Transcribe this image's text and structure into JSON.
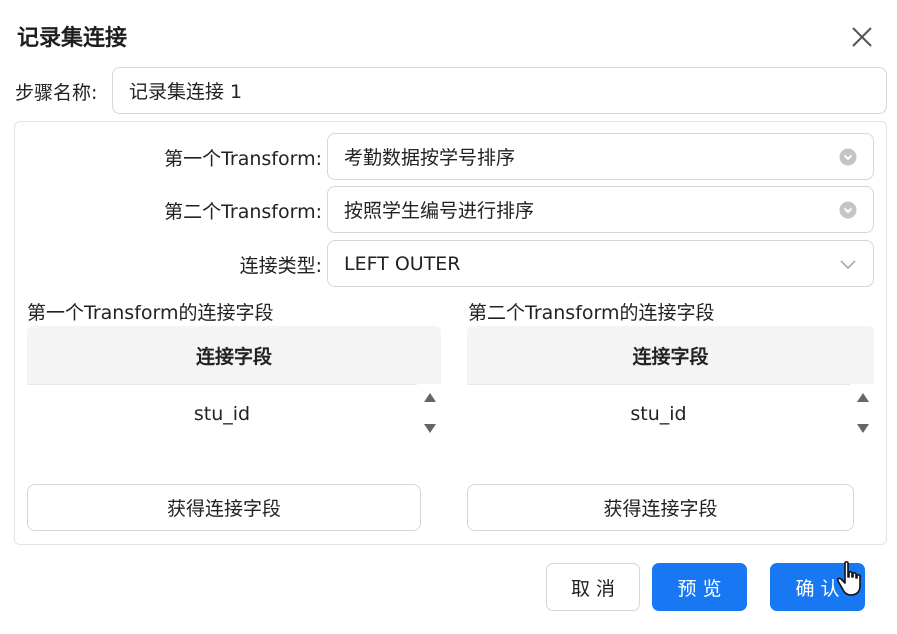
{
  "dialog": {
    "title": "记录集连接",
    "close_icon": "close-icon"
  },
  "step": {
    "label": "步骤名称:",
    "value": "记录集连接 1"
  },
  "form": {
    "first_transform": {
      "label": "第一个Transform:",
      "value": "考勤数据按学号排序",
      "icon": "chevron-circle-down-icon"
    },
    "second_transform": {
      "label": "第二个Transform:",
      "value": "按照学生编号进行排序",
      "icon": "chevron-circle-down-icon"
    },
    "join_type": {
      "label": "连接类型:",
      "value": "LEFT OUTER",
      "icon": "chevron-down-icon"
    }
  },
  "left_fields": {
    "title": "第一个Transform的连接字段",
    "column_header": "连接字段",
    "rows": [
      "stu_id"
    ],
    "button": "获得连接字段"
  },
  "right_fields": {
    "title": "第二个Transform的连接字段",
    "column_header": "连接字段",
    "rows": [
      "stu_id"
    ],
    "button": "获得连接字段"
  },
  "footer": {
    "cancel": "取消",
    "preview": "预览",
    "confirm": "确认"
  },
  "colors": {
    "primary": "#1877f2",
    "border": "#d6d6d6",
    "header_bg": "#f4f4f4"
  }
}
